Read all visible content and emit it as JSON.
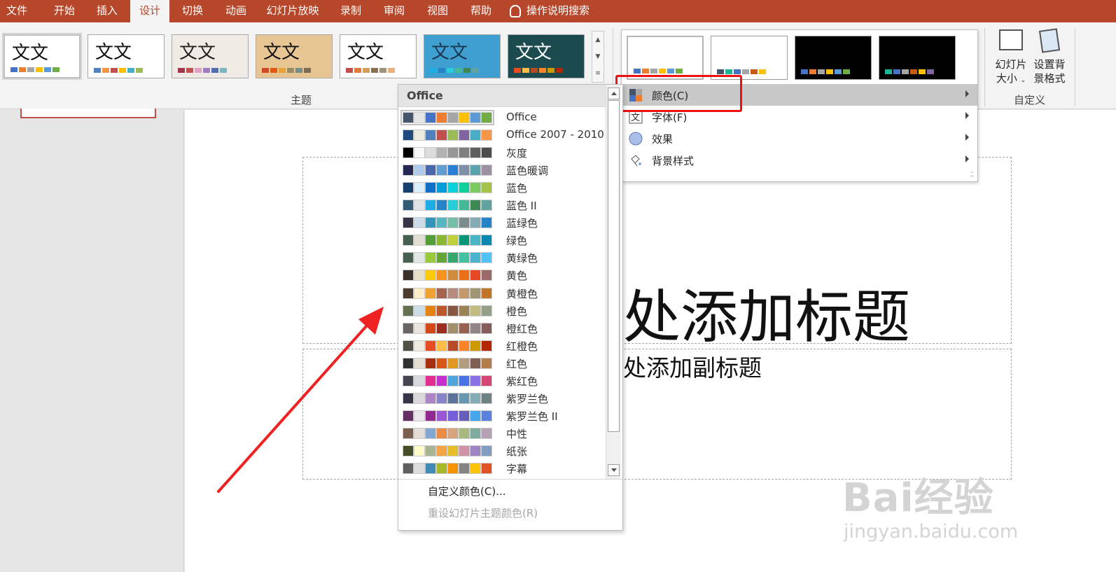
{
  "tabs": [
    "文件",
    "开始",
    "插入",
    "设计",
    "切换",
    "动画",
    "幻灯片放映",
    "录制",
    "审阅",
    "视图",
    "帮助"
  ],
  "active_tab": "设计",
  "search_label": "操作说明搜索",
  "ribbon": {
    "theme_group_label": "主题",
    "theme_thumb_text": "文文",
    "custom_group_label": "自定义",
    "slide_size_label_1": "幻灯片",
    "slide_size_label_2": "大小",
    "bg_format_label_1": "设置背",
    "bg_format_label_2": "景格式"
  },
  "themes": [
    {
      "bg": "#ffffff",
      "text_color": "#111111",
      "swatches": [
        "#4472c4",
        "#ed7d31",
        "#a5a5a5",
        "#ffc000",
        "#5b9bd5",
        "#70ad47"
      ]
    },
    {
      "bg": "#ffffff",
      "text_color": "#111111",
      "swatches": [
        "#4f81bd",
        "#f79646",
        "#c0504d",
        "#ffc000",
        "#4bacc6",
        "#9bbb59"
      ]
    },
    {
      "bg": "#f1ebe6",
      "text_color": "#222222",
      "swatches": [
        "#a5344d",
        "#c0504d",
        "#e0a3c5",
        "#9f7dbf",
        "#4e6db1",
        "#7ab6c4"
      ]
    },
    {
      "bg": "#e7c693",
      "text_color": "#111111",
      "swatches": [
        "#d24726",
        "#dd5a13",
        "#e8a23a",
        "#9a8b63",
        "#738d85",
        "#7c6b56"
      ]
    },
    {
      "bg": "#ffffff",
      "text_color": "#111111",
      "swatches": [
        "#c0504d",
        "#e07a3c",
        "#d39e58",
        "#8b7153",
        "#a0927a",
        "#e8b27a"
      ]
    },
    {
      "bg": "#3f9fd1",
      "text_color": "#1a3550",
      "swatches": [
        "#1cade4",
        "#2683c6",
        "#27ced7",
        "#42ba97",
        "#3e8853",
        "#62a39f"
      ]
    },
    {
      "bg": "#1b4a4f",
      "text_color": "#ffffff",
      "swatches": [
        "#e84c22",
        "#ffbd47",
        "#b64926",
        "#ff8427",
        "#cc9900",
        "#b22600"
      ]
    }
  ],
  "variants": [
    {
      "bg": "#ffffff",
      "swatches": [
        "#4472c4",
        "#ed7d31",
        "#a5a5a5",
        "#ffc000",
        "#5b9bd5",
        "#70ad47"
      ]
    },
    {
      "bg": "#ffffff",
      "swatches": [
        "#44546a",
        "#1cb397",
        "#4472c4",
        "#a5a5a5",
        "#c55a11",
        "#ffc000"
      ]
    },
    {
      "bg": "#000000",
      "swatches": [
        "#4472c4",
        "#ed7d31",
        "#a5a5a5",
        "#ffc000",
        "#5b9bd5",
        "#70ad47"
      ]
    },
    {
      "bg": "#000000",
      "swatches": [
        "#1cb397",
        "#4472c4",
        "#a5a5a5",
        "#c55a11",
        "#ffc000",
        "#8064a2"
      ]
    }
  ],
  "variant_menu": [
    {
      "label": "颜色(C)",
      "icon": "color-palette-icon",
      "highlighted": true
    },
    {
      "label": "字体(F)",
      "icon": "font-icon",
      "highlighted": false
    },
    {
      "label": "效果",
      "icon": "effects-icon",
      "highlighted": false
    },
    {
      "label": "背景样式",
      "icon": "background-style-icon",
      "highlighted": false
    }
  ],
  "color_menu": {
    "header": "Office",
    "schemes": [
      {
        "name": "Office",
        "swatches": [
          "#44546a",
          "#e7e6e6",
          "#4472c4",
          "#ed7d31",
          "#a5a5a5",
          "#ffc000",
          "#5b9bd5",
          "#70ad47"
        ]
      },
      {
        "name": "Office 2007 - 2010",
        "swatches": [
          "#1f497d",
          "#eeece1",
          "#4f81bd",
          "#c0504d",
          "#9bbb59",
          "#8064a2",
          "#4bacc6",
          "#f79646"
        ]
      },
      {
        "name": "灰度",
        "swatches": [
          "#000000",
          "#f8f8f8",
          "#dddddd",
          "#b2b2b2",
          "#969696",
          "#808080",
          "#5f5f5f",
          "#4d4d4d"
        ]
      },
      {
        "name": "蓝色暖调",
        "swatches": [
          "#242852",
          "#acccea",
          "#4a66ac",
          "#629dd1",
          "#297fd5",
          "#7f8fa9",
          "#5aa2ae",
          "#9d90a0"
        ]
      },
      {
        "name": "蓝色",
        "swatches": [
          "#17406d",
          "#dbeff9",
          "#0f6fc6",
          "#009dd9",
          "#0bd0d9",
          "#10cf9b",
          "#7cca62",
          "#a5c249"
        ]
      },
      {
        "name": "蓝色 II",
        "swatches": [
          "#335b74",
          "#dfe3e5",
          "#1cade4",
          "#2683c6",
          "#27ced7",
          "#42ba97",
          "#3e8853",
          "#62a39f"
        ]
      },
      {
        "name": "蓝绿色",
        "swatches": [
          "#373545",
          "#cedbe6",
          "#3494ba",
          "#58b6c0",
          "#75bda7",
          "#7a8c8e",
          "#84acb6",
          "#2683c6"
        ]
      },
      {
        "name": "绿色",
        "swatches": [
          "#455f51",
          "#e3ded1",
          "#549e39",
          "#8ab833",
          "#c0cf3a",
          "#029676",
          "#4ab5c4",
          "#0989b1"
        ]
      },
      {
        "name": "黄绿色",
        "swatches": [
          "#455f51",
          "#e2e8e6",
          "#99cb38",
          "#63a537",
          "#37a76f",
          "#44c1a3",
          "#4eb3cf",
          "#51c3f9"
        ]
      },
      {
        "name": "黄色",
        "swatches": [
          "#39302a",
          "#e5dec9",
          "#ffca08",
          "#f8931d",
          "#ce8d3e",
          "#ec7016",
          "#e64823",
          "#9c6a6a"
        ]
      },
      {
        "name": "黄橙色",
        "swatches": [
          "#4e3b30",
          "#fbeec9",
          "#f0a22e",
          "#a5644e",
          "#b58b80",
          "#c3986d",
          "#a19574",
          "#c17529"
        ]
      },
      {
        "name": "橙色",
        "swatches": [
          "#637052",
          "#ccddea",
          "#e48312",
          "#bd582c",
          "#865640",
          "#9b8357",
          "#c2bc80",
          "#94a088"
        ]
      },
      {
        "name": "橙红色",
        "swatches": [
          "#696464",
          "#e9e5dc",
          "#d34817",
          "#9b2d1f",
          "#a28e6a",
          "#956251",
          "#918485",
          "#855d5d"
        ]
      },
      {
        "name": "红橙色",
        "swatches": [
          "#505046",
          "#eeece1",
          "#e84c22",
          "#ffbd47",
          "#b64926",
          "#ff8427",
          "#cc9900",
          "#b22600"
        ]
      },
      {
        "name": "红色",
        "swatches": [
          "#323232",
          "#e3ded1",
          "#a5300f",
          "#d55816",
          "#e19825",
          "#b19c7d",
          "#7f5f52",
          "#b27d49"
        ]
      },
      {
        "name": "紫红色",
        "swatches": [
          "#454551",
          "#d8d9dc",
          "#e32d91",
          "#c830cc",
          "#4ea6dc",
          "#4775e7",
          "#8971e1",
          "#d54773"
        ]
      },
      {
        "name": "紫罗兰色",
        "swatches": [
          "#373545",
          "#dcd8dc",
          "#ad84c6",
          "#8784c7",
          "#5d739a",
          "#6997af",
          "#84acb6",
          "#6f8183"
        ]
      },
      {
        "name": "紫罗兰色 II",
        "swatches": [
          "#632e62",
          "#eae5eb",
          "#92278f",
          "#9b57d3",
          "#755dd9",
          "#665eb8",
          "#45a5ed",
          "#5982db"
        ]
      },
      {
        "name": "中性",
        "swatches": [
          "#7a5f51",
          "#e6ddd6",
          "#82a8d2",
          "#ec8b45",
          "#d7a37f",
          "#a8b97f",
          "#7fab9f",
          "#b5a1b3"
        ]
      },
      {
        "name": "纸张",
        "swatches": [
          "#444d26",
          "#fefac9",
          "#a5b592",
          "#f3a447",
          "#e7bc29",
          "#d092a7",
          "#9c85c0",
          "#809ec2"
        ]
      },
      {
        "name": "字幕",
        "swatches": [
          "#5e5e5e",
          "#dddddd",
          "#418ab3",
          "#a6b727",
          "#f69200",
          "#838383",
          "#fec306",
          "#df5327"
        ]
      }
    ],
    "custom_colors": "自定义颜色(C)...",
    "reset_colors": "重设幻灯片主题颜色(R)"
  },
  "slide": {
    "title_placeholder": "处添加标题",
    "subtitle_placeholder": "处添加副标题"
  },
  "watermark": {
    "logo": "Bai经验",
    "url": "jingyan.baidu.com"
  },
  "colors": {
    "ribbon_accent": "#b7472a",
    "highlight_red": "#ee1111",
    "menu_highlight": "#c8c8c8"
  }
}
